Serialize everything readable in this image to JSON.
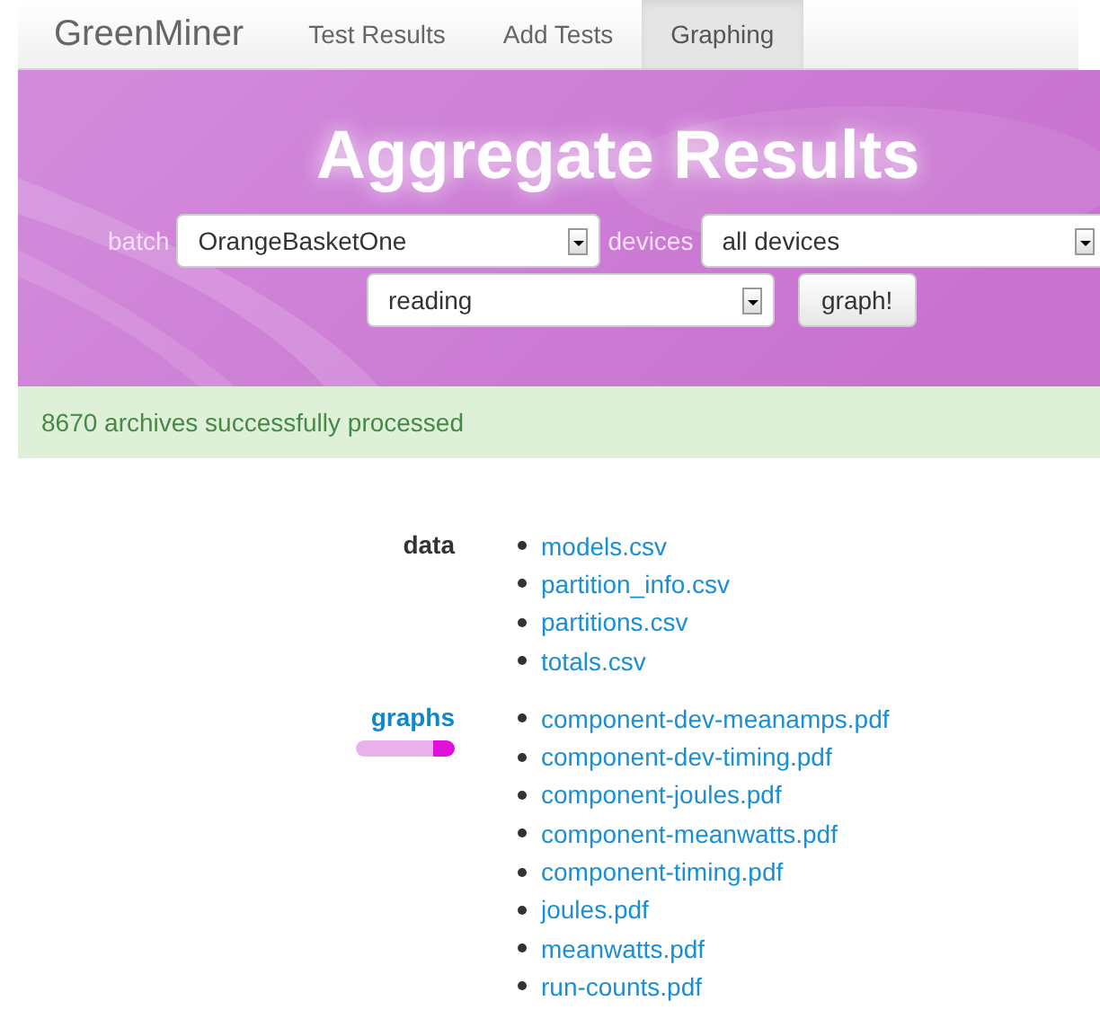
{
  "navbar": {
    "brand": "GreenMiner",
    "tabs": [
      {
        "label": "Test Results",
        "selected": false
      },
      {
        "label": "Add Tests",
        "selected": false
      },
      {
        "label": "Graphing",
        "selected": true
      }
    ]
  },
  "hero": {
    "title": "Aggregate Results",
    "batch_label": "batch",
    "batch_value": "OrangeBasketOne",
    "devices_label": "devices",
    "devices_value": "all devices",
    "mode_value": "reading",
    "button": "graph!"
  },
  "alert": {
    "text": "8670 archives successfully processed"
  },
  "groups": [
    {
      "label": "data",
      "highlighted": false,
      "files": [
        "models.csv",
        "partition_info.csv",
        "partitions.csv",
        "totals.csv"
      ]
    },
    {
      "label": "graphs",
      "highlighted": true,
      "files": [
        "component-dev-meanamps.pdf",
        "component-dev-timing.pdf",
        "component-joules.pdf",
        "component-meanwatts.pdf",
        "component-timing.pdf",
        "joules.pdf",
        "meanwatts.pdf",
        "run-counts.pdf"
      ]
    }
  ]
}
